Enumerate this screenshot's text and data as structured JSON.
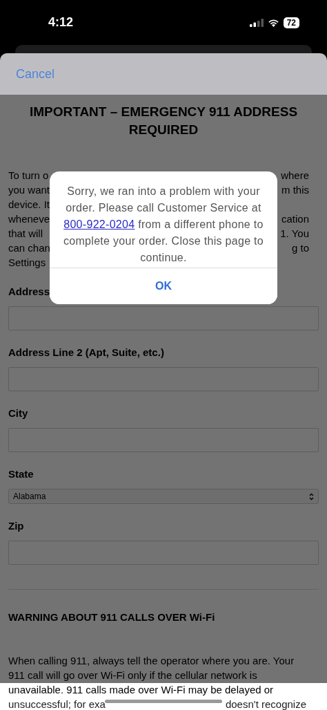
{
  "status_bar": {
    "time": "4:12",
    "battery": "72"
  },
  "sheet_header": {
    "cancel": "Cancel"
  },
  "page": {
    "title": "IMPORTANT – EMERGENCY 911 ADDRESS REQUIRED",
    "intro_lines": [
      {
        "left": "To turn o",
        "right": "where"
      },
      {
        "left": "you want",
        "right": "m this"
      },
      {
        "left": "device. It"
      },
      {
        "left": "wheneve",
        "right": "cation"
      },
      {
        "left": "that will",
        "right": "1. You"
      },
      {
        "left": "can chan",
        "right": "g to"
      },
      {
        "left": "Settings"
      }
    ],
    "fields": [
      {
        "label": "Address",
        "kind": "text"
      },
      {
        "label": "Address Line 2 (Apt, Suite, etc.)",
        "kind": "text"
      },
      {
        "label": "City",
        "kind": "text"
      },
      {
        "label": "State",
        "kind": "select",
        "value": "Alabama"
      },
      {
        "label": "Zip",
        "kind": "text"
      }
    ],
    "warning": {
      "heading": "WARNING ABOUT 911 CALLS OVER Wi-Fi",
      "lines": [
        "When calling 911, always tell the operator where you are. Your",
        "911 call will go over Wi-Fi only if the cellular network is",
        "unavailable. 911 calls made over Wi-Fi may be delayed or"
      ],
      "last_line": {
        "left": "unsuccessful; for exa",
        "right": "doesn't recognize"
      }
    }
  },
  "alert": {
    "message_before": "Sorry, we ran into a problem with your order. Please call Customer Service at",
    "link": "800-922-0204",
    "message_after": "from a different phone to complete your order. Close this page to continue.",
    "button": "OK"
  }
}
